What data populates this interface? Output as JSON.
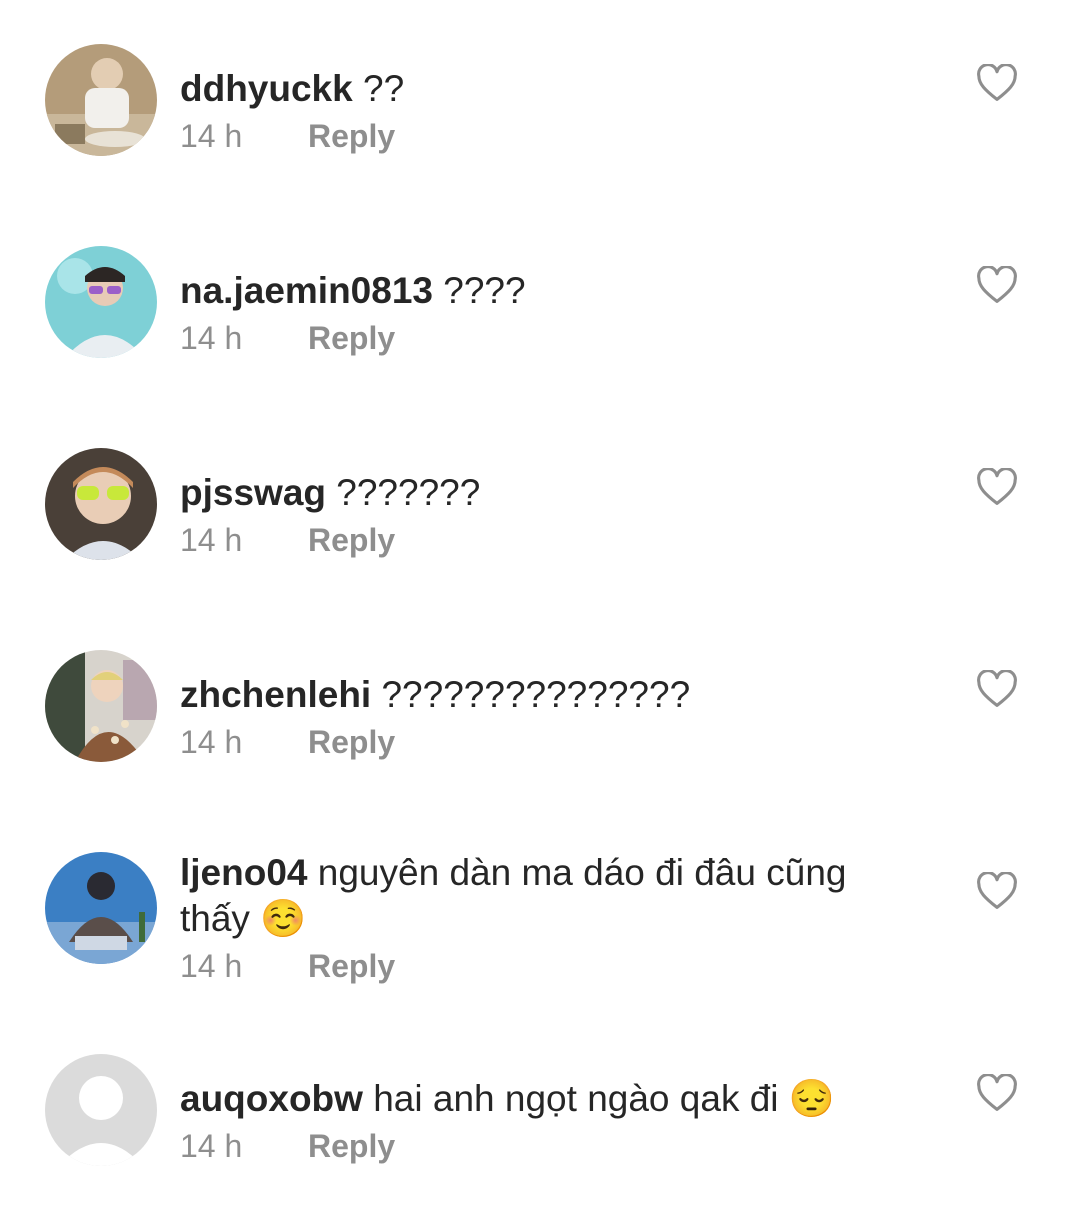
{
  "comments": [
    {
      "username": "ddhyuckk",
      "text": "??",
      "time": "14 h",
      "reply_label": "Reply",
      "avatar": "photo-avatar"
    },
    {
      "username": "na.jaemin0813",
      "text": "????",
      "time": "14 h",
      "reply_label": "Reply",
      "avatar": "photo-avatar"
    },
    {
      "username": "pjsswag",
      "text": "???????",
      "time": "14 h",
      "reply_label": "Reply",
      "avatar": "photo-avatar"
    },
    {
      "username": "zhchenlehi",
      "text": "???????????????",
      "time": "14 h",
      "reply_label": "Reply",
      "avatar": "photo-avatar"
    },
    {
      "username": "ljeno04",
      "text": "nguyên dàn ma dáo đi đâu cũng thấy ☺️",
      "time": "14 h",
      "reply_label": "Reply",
      "avatar": "photo-avatar"
    },
    {
      "username": "auqoxobw",
      "text": "hai anh ngọt ngào qak đi 😔",
      "time": "14 h",
      "reply_label": "Reply",
      "avatar": "default-avatar"
    }
  ],
  "icons": {
    "like": "heart-outline-icon"
  },
  "colors": {
    "text": "#262626",
    "muted": "#8e8e8e",
    "heart": "#8e8e8e",
    "default_avatar": "#dbdbdb"
  }
}
